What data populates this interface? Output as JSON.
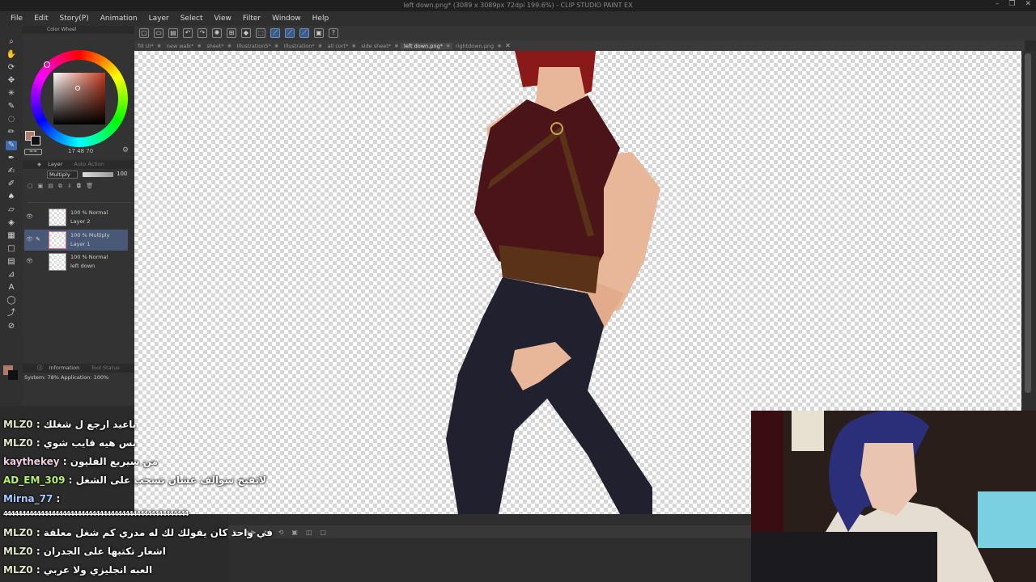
{
  "window": {
    "title": "left down.png* (3089 x 3089px 72dpi 199.6%) - CLIP STUDIO PAINT EX",
    "controls": [
      "–",
      "❐",
      "✕"
    ]
  },
  "menu": [
    "File",
    "Edit",
    "Story(P)",
    "Animation",
    "Layer",
    "Select",
    "View",
    "Filter",
    "Window",
    "Help"
  ],
  "tabs": [
    {
      "label": "fill UI*",
      "active": false
    },
    {
      "label": "new walk*",
      "active": false
    },
    {
      "label": "sheet*",
      "active": false
    },
    {
      "label": "Illustration5*",
      "active": false
    },
    {
      "label": "Illustration*",
      "active": false
    },
    {
      "label": "all cort*",
      "active": false
    },
    {
      "label": "side sheet*",
      "active": false
    },
    {
      "label": "left down.png*",
      "active": true
    },
    {
      "label": "rightdown.png",
      "active": false
    }
  ],
  "color_panel": {
    "title": "Color Wheel",
    "hsv_readout": "17  48  70",
    "main_color": "#b07a6a",
    "sub_color": "#111111"
  },
  "layer_panel": {
    "title": "Layer",
    "tab2": "Auto Action",
    "blend_mode": "Multiply",
    "opacity": "100",
    "layers": [
      {
        "mode": "100 % Normal",
        "name": "Layer 2",
        "selected": false
      },
      {
        "mode": "100 % Multiply",
        "name": "Layer 1",
        "selected": true
      },
      {
        "mode": "100 % Normal",
        "name": "left down",
        "selected": false
      }
    ]
  },
  "info_panel": {
    "title": "Information",
    "tab2": "Tool Status",
    "memory": "System: 78%  Application: 100%"
  },
  "chat": [
    {
      "user": "MLZ0",
      "text": "باعيد ارجع ل شغلك"
    },
    {
      "user": "MLZ0",
      "text": "بس هيه قايب شوي"
    },
    {
      "user": "kaythekey",
      "text": "من سيريع الفليون"
    },
    {
      "user": "AD_EM_309",
      "text": "لاتفتح سوالف عشان تسحب على الشغل"
    },
    {
      "user": "Mirna_77",
      "text": ""
    },
    {
      "user": "",
      "text": "44444444444444444444444444444444444444444444444444"
    },
    {
      "user": "MLZ0",
      "text": "في واحد كان يقولك لك له مدري كم شغل معلقة"
    },
    {
      "user": "MLZ0",
      "text": "اشعار تكتبها على الجدران"
    },
    {
      "user": "MLZ0",
      "text": "العبه انجليزي ولا عربي"
    }
  ],
  "colors": {
    "accent": "#3f6cb0",
    "shirt": "#4a1418",
    "pants": "#20202e",
    "skin": "#e8b79a",
    "hair": "#8a1a1a",
    "belt": "#5a3218"
  }
}
